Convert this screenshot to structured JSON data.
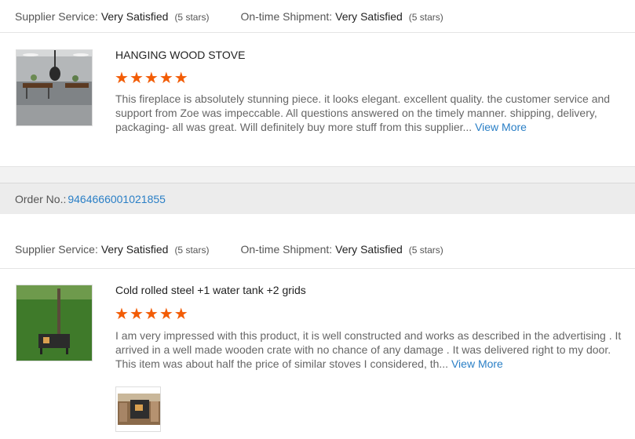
{
  "review1": {
    "supplier_service_label": "Supplier Service:",
    "supplier_service_value": "Very Satisfied",
    "supplier_service_stars": "(5 stars)",
    "shipment_label": "On-time Shipment:",
    "shipment_value": "Very Satisfied",
    "shipment_stars": "(5 stars)",
    "product_title": "HANGING WOOD STOVE",
    "rating": 5,
    "body": "This fireplace is absolutely stunning piece. it looks elegant. excellent quality. the customer service and support from Zoe was impeccable. All questions answered on the timely manner. shipping, delivery, packaging- all was great. Will definitely buy more stuff from this supplier...",
    "view_more": "View More",
    "image_icon": "living-room-stove-photo"
  },
  "order": {
    "label": "Order No.:",
    "number": "9464666001021855"
  },
  "review2": {
    "supplier_service_label": "Supplier Service:",
    "supplier_service_value": "Very Satisfied",
    "supplier_service_stars": "(5 stars)",
    "shipment_label": "On-time Shipment:",
    "shipment_value": "Very Satisfied",
    "shipment_stars": "(5 stars)",
    "product_title": "Cold rolled steel +1 water tank +2 grids",
    "rating": 5,
    "body": "I am very impressed with this product, it is well constructed and works as described in the advertising . It arrived in a well made wooden crate with no chance of any damage . It was delivered right to my door. This item was about half the price of similar stoves I considered, th...",
    "view_more": "View More",
    "image_icon": "outdoor-stove-photo",
    "attachment_icon": "stove-attachment-photo"
  },
  "colors": {
    "star": "#f25c05",
    "link": "#2a7fc6"
  }
}
